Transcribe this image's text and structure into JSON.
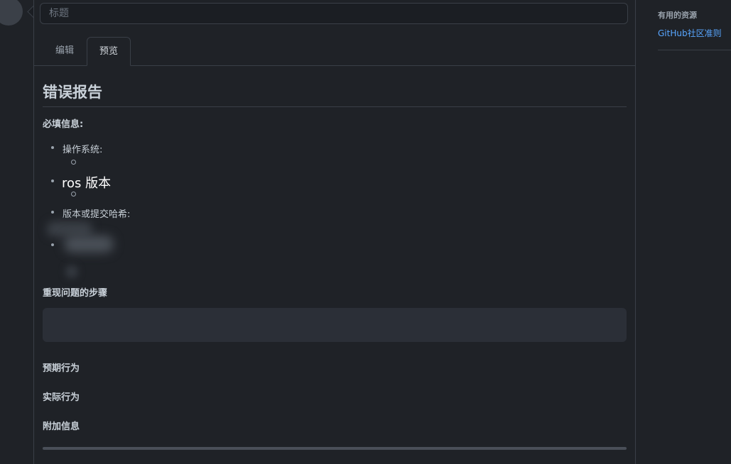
{
  "issue_form": {
    "title_placeholder": "标题",
    "tabs": [
      {
        "label": "编辑",
        "active": false
      },
      {
        "label": "预览",
        "active": true
      }
    ]
  },
  "preview": {
    "heading": "错误报告",
    "required_info_label": "必填信息:",
    "list_items": [
      {
        "label": "操作系统:"
      },
      {
        "label": "ros 版本"
      },
      {
        "label": "版本或提交哈希:"
      }
    ],
    "steps_label": "重现问题的步骤",
    "expected_label": "预期行为",
    "actual_label": "实际行为",
    "additional_label": "附加信息"
  },
  "sidebar": {
    "title": "有用的资源",
    "link": "GitHub社区准则"
  },
  "colors": {
    "background": "#1f2227",
    "border": "#3a3f47",
    "link": "#58a6ff",
    "text": "#c9d1d9"
  }
}
